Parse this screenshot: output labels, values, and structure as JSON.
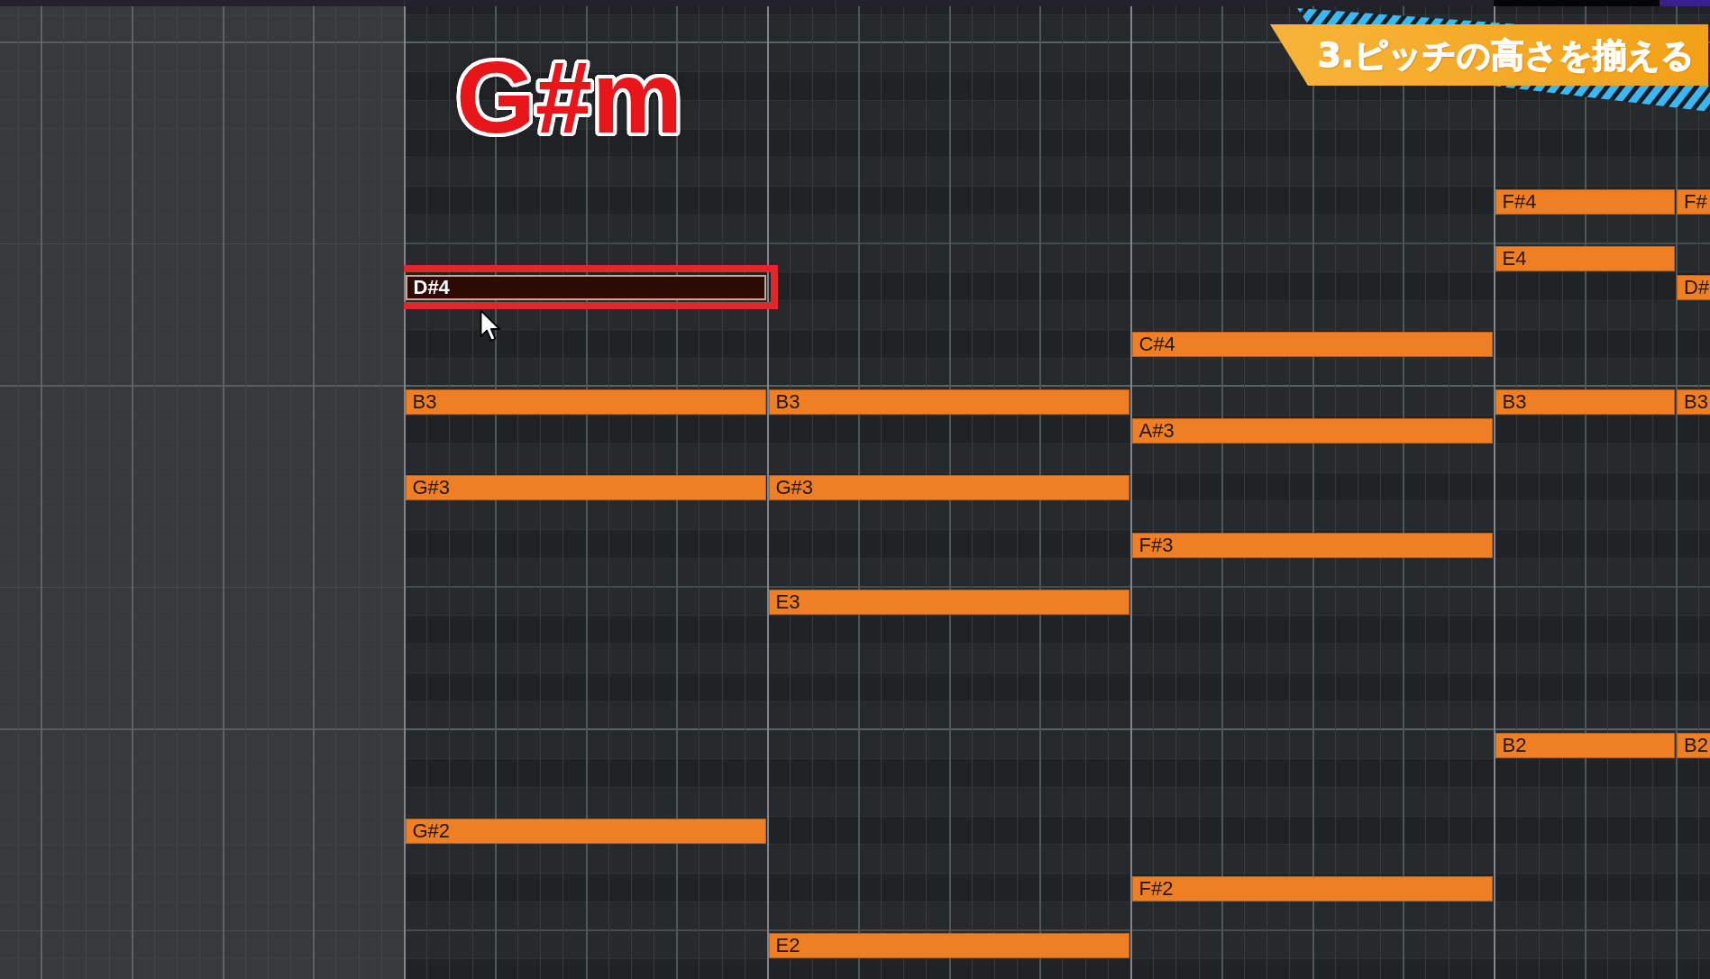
{
  "chord_label": "G#m",
  "section_banner": "3.ピッチの高さを揃える",
  "notes": [
    {
      "label": "F#4",
      "selected": false,
      "highlighted": false
    },
    {
      "label": "F#",
      "selected": false,
      "highlighted": false
    },
    {
      "label": "E4",
      "selected": false,
      "highlighted": false
    },
    {
      "label": "D#4",
      "selected": true,
      "highlighted": true
    },
    {
      "label": "D#",
      "selected": false,
      "highlighted": false
    },
    {
      "label": "C#4",
      "selected": false,
      "highlighted": false
    },
    {
      "label": "B3",
      "selected": false,
      "highlighted": false
    },
    {
      "label": "B3",
      "selected": false,
      "highlighted": false
    },
    {
      "label": "B3",
      "selected": false,
      "highlighted": false
    },
    {
      "label": "B3",
      "selected": false,
      "highlighted": false
    },
    {
      "label": "A#3",
      "selected": false,
      "highlighted": false
    },
    {
      "label": "G#3",
      "selected": false,
      "highlighted": false
    },
    {
      "label": "G#3",
      "selected": false,
      "highlighted": false
    },
    {
      "label": "F#3",
      "selected": false,
      "highlighted": false
    },
    {
      "label": "E3",
      "selected": false,
      "highlighted": false
    },
    {
      "label": "B2",
      "selected": false,
      "highlighted": false
    },
    {
      "label": "B2",
      "selected": false,
      "highlighted": false
    },
    {
      "label": "G#2",
      "selected": false,
      "highlighted": false
    },
    {
      "label": "F#2",
      "selected": false,
      "highlighted": false
    },
    {
      "label": "E2",
      "selected": false,
      "highlighted": false
    }
  ]
}
